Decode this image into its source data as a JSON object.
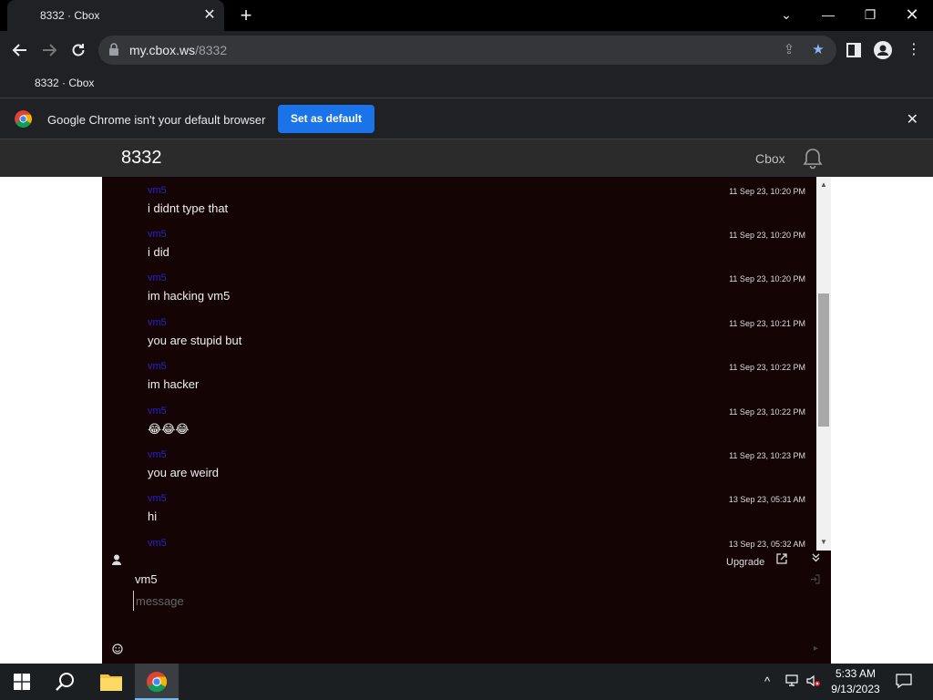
{
  "browser": {
    "tab_title": "8332 · Cbox",
    "new_tab_label": "+",
    "url_host": "my.cbox.ws",
    "url_path": "/8332",
    "bookmark": "8332 · Cbox",
    "infobar_message": "Google Chrome isn't your default browser",
    "infobar_button": "Set as default"
  },
  "site": {
    "title": "8332",
    "brand": "Cbox"
  },
  "chat": {
    "messages": [
      {
        "name": "vm5",
        "text": "i didnt type that",
        "time": "11 Sep 23, 10:20 PM"
      },
      {
        "name": "vm5",
        "text": "i did",
        "time": "11 Sep 23, 10:20 PM"
      },
      {
        "name": "vm5",
        "text": "im hacking vm5",
        "time": "11 Sep 23, 10:20 PM"
      },
      {
        "name": "vm5",
        "text": "you are stupid but",
        "time": "11 Sep 23, 10:21 PM"
      },
      {
        "name": "vm5",
        "text": "im hacker",
        "time": "11 Sep 23, 10:22 PM"
      },
      {
        "name": "vm5",
        "text": "😂😂😂",
        "time": "11 Sep 23, 10:22 PM"
      },
      {
        "name": "vm5",
        "text": "you are weird",
        "time": "11 Sep 23, 10:23 PM"
      },
      {
        "name": "vm5",
        "text": "hi",
        "time": "13 Sep 23, 05:31 AM"
      },
      {
        "name": "vm5",
        "text": "",
        "time": "13 Sep 23, 05:32 AM"
      }
    ],
    "upgrade_label": "Upgrade",
    "nickname": "vm5",
    "message_placeholder": "message"
  },
  "taskbar": {
    "time": "5:33 AM",
    "date": "9/13/2023"
  },
  "colors": {
    "chat_bg": "#140404",
    "name_color": "#2a1fd0",
    "chrome_accent": "#1a73e8"
  }
}
